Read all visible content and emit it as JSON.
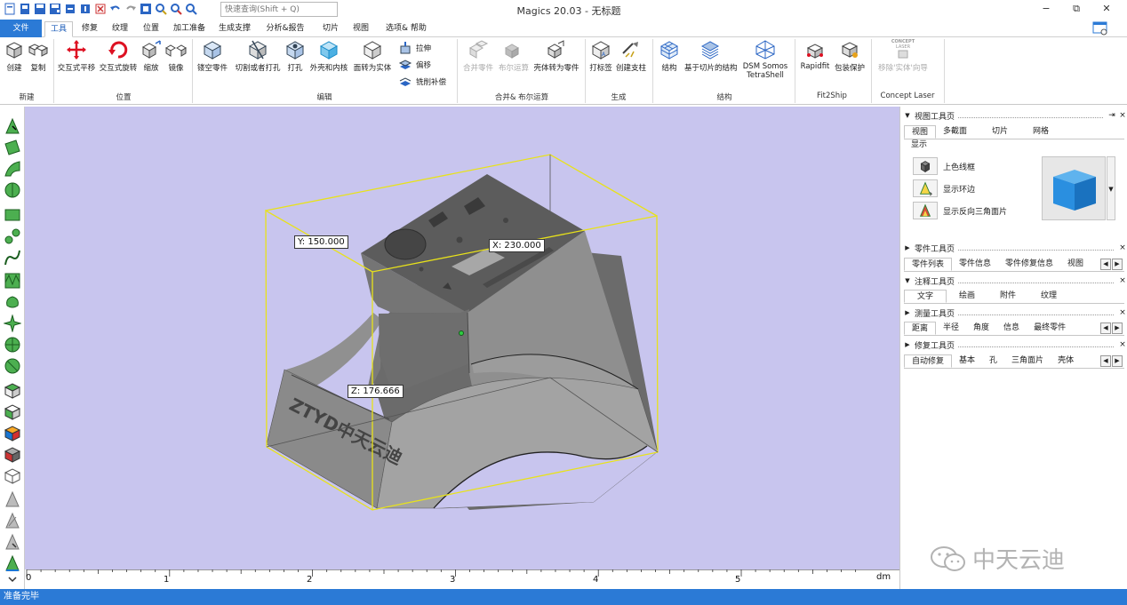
{
  "window": {
    "title": "Magics 20.03 - 无标题",
    "search_placeholder": "快速查询(Shift + Q)",
    "controls": [
      "−",
      "⧉",
      "✕"
    ]
  },
  "tabs": [
    "文件",
    "工具",
    "修复",
    "纹理",
    "位置",
    "加工准备",
    "生成支撑",
    "分析&报告",
    "切片",
    "视图",
    "选项& 帮助"
  ],
  "ribbon": {
    "new": {
      "create": "创建",
      "copy": "复制",
      "group": "新建"
    },
    "position": {
      "interactive_translate": "交互式平移",
      "interactive_rotate": "交互式旋转",
      "scale": "缩放",
      "mirror": "镜像",
      "group": "位置"
    },
    "edit": {
      "hollow": "镂空零件",
      "cut_punch": "切割或者打孔",
      "punch": "打孔",
      "shell": "外壳和内核",
      "to_solid": "面转为实体",
      "extrude": "拉伸",
      "offset": "偏移",
      "mill_comp": "铣削补偿",
      "group": "编辑"
    },
    "boolean": {
      "merge": "合并零件",
      "boolean": "布尔运算",
      "shell_to_part": "壳体转为零件",
      "group": "合并& 布尔运算"
    },
    "generate": {
      "label": "打标签",
      "support": "创建支柱",
      "group": "生成"
    },
    "structure": {
      "structure": "结构",
      "slice_structure": "基于切片的结构",
      "dsm_line1": "DSM Somos",
      "dsm_line2": "TetraShell",
      "group": "结构"
    },
    "fit2ship": {
      "rapidfit": "Rapidfit",
      "package": "包装保护",
      "group": "Fit2Ship"
    },
    "concept": {
      "remove_wizard": "移除'实体'向导",
      "logo_top": "CONCEPT",
      "logo_bottom": "LASER",
      "group": "Concept Laser"
    }
  },
  "viewport": {
    "dim_x": "X: 230.000",
    "dim_y": "Y: 150.000",
    "dim_z": "Z: 176.666",
    "engraving": "ZTYD中天云迪"
  },
  "ruler": {
    "ticks": [
      "0",
      "1",
      "2",
      "3",
      "4",
      "5"
    ],
    "unit": "dm"
  },
  "panels": {
    "view": {
      "title": "视图工具页",
      "tabs": [
        "视图",
        "多截面",
        "切片",
        "网格"
      ],
      "display_label": "显示",
      "options": [
        "上色线框",
        "显示环边",
        "显示反向三角面片"
      ]
    },
    "part": {
      "title": "零件工具页",
      "tabs": [
        "零件列表",
        "零件信息",
        "零件修复信息",
        "视图"
      ]
    },
    "annotation": {
      "title": "注释工具页",
      "tabs": [
        "文字",
        "绘画",
        "附件",
        "纹理"
      ]
    },
    "measure": {
      "title": "测量工具页",
      "tabs": [
        "距离",
        "半径",
        "角度",
        "信息",
        "最终零件"
      ]
    },
    "repair": {
      "title": "修复工具页",
      "tabs": [
        "自动修复",
        "基本",
        "孔",
        "三角面片",
        "壳体"
      ]
    }
  },
  "status": "准备完毕",
  "watermark": "中天云迪",
  "colors": {
    "accent": "#2b7ad6",
    "viewport_bg": "#c8c5ee",
    "bbox": "#e8e21a",
    "part": "#8a8a8a"
  }
}
